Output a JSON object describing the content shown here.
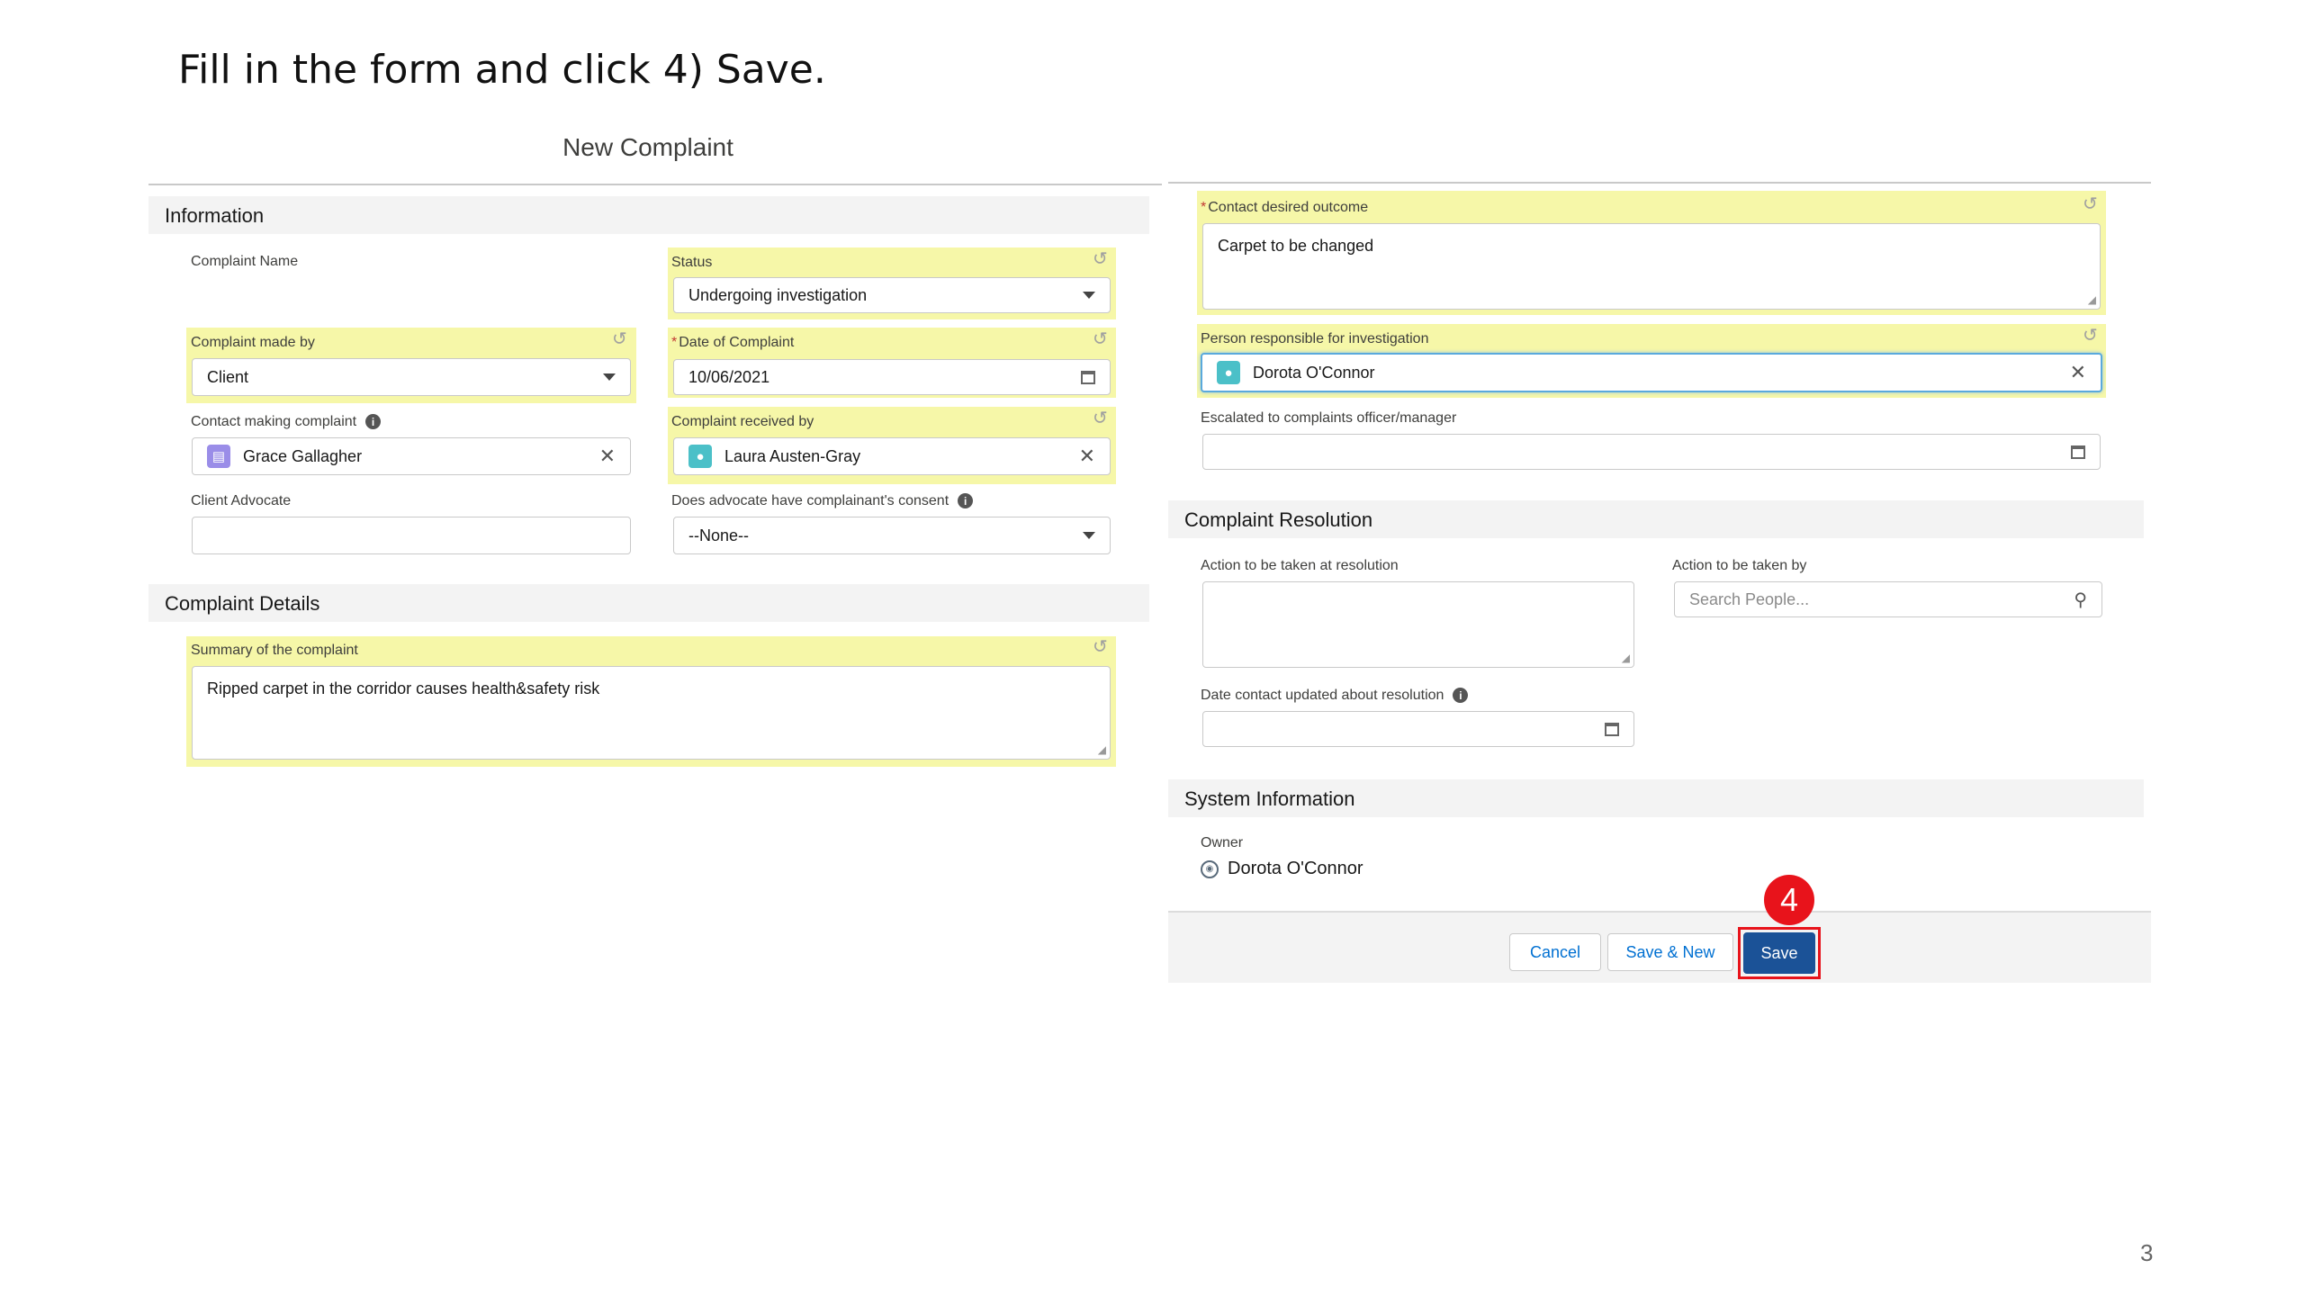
{
  "slide": {
    "instruction": "Fill in the form and click 4) Save.",
    "page_number": "3"
  },
  "form": {
    "title": "New Complaint"
  },
  "information": {
    "heading": "Information",
    "complaint_name_label": "Complaint Name",
    "status_label": "Status",
    "status_value": "Undergoing investigation",
    "made_by_label": "Complaint made by",
    "made_by_value": "Client",
    "date_label": "Date of Complaint",
    "date_value": "10/06/2021",
    "contact_label": "Contact making complaint",
    "contact_value": "Grace Gallagher",
    "received_by_label": "Complaint received by",
    "received_by_value": "Laura Austen-Gray",
    "advocate_label": "Client Advocate",
    "advocate_value": "",
    "consent_label": "Does advocate have complainant's consent",
    "consent_value": "--None--"
  },
  "details": {
    "heading": "Complaint Details",
    "summary_label": "Summary of the complaint",
    "summary_value": "Ripped carpet in the corridor causes health&safety risk"
  },
  "right": {
    "outcome_label": "Contact desired outcome",
    "outcome_value": "Carpet to be changed",
    "responsible_label": "Person responsible for investigation",
    "responsible_value": "Dorota O'Connor",
    "escalated_label": "Escalated to complaints officer/manager",
    "escalated_value": ""
  },
  "resolution": {
    "heading": "Complaint Resolution",
    "action_label": "Action to be taken at resolution",
    "action_value": "",
    "action_by_label": "Action to be taken by",
    "action_by_placeholder": "Search People...",
    "date_updated_label": "Date contact updated about resolution",
    "date_updated_value": ""
  },
  "system": {
    "heading": "System Information",
    "owner_label": "Owner",
    "owner_value": "Dorota O'Connor"
  },
  "footer": {
    "cancel": "Cancel",
    "save_new": "Save & New",
    "save": "Save",
    "step_badge": "4"
  },
  "colors": {
    "highlight": "#f6f7a8",
    "primary_button": "#1b5297",
    "callout_red": "#e8131b",
    "contact_icon": "#9a8de8",
    "user_icon": "#4bc0c8"
  },
  "icons": [
    "undo-icon",
    "chevron-down-icon",
    "calendar-icon",
    "clear-icon",
    "contact-card-icon",
    "user-icon",
    "info-icon",
    "search-icon",
    "avatar-icon"
  ]
}
